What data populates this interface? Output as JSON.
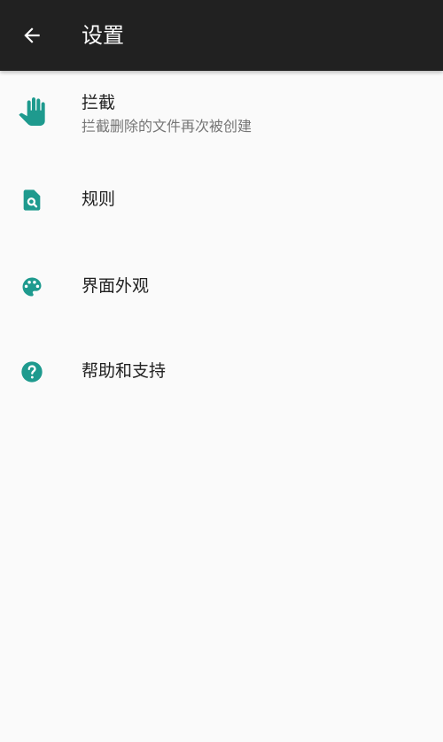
{
  "appbar": {
    "title": "设置",
    "back_icon": "arrow-back-icon",
    "background": "#212121"
  },
  "accent": "#1e9a8e",
  "items": [
    {
      "icon": "hand-icon",
      "title": "拦截",
      "subtitle": "拦截删除的文件再次被创建"
    },
    {
      "icon": "file-search-icon",
      "title": "规则"
    },
    {
      "icon": "palette-icon",
      "title": "界面外观"
    },
    {
      "icon": "help-circle-icon",
      "title": "帮助和支持"
    }
  ]
}
